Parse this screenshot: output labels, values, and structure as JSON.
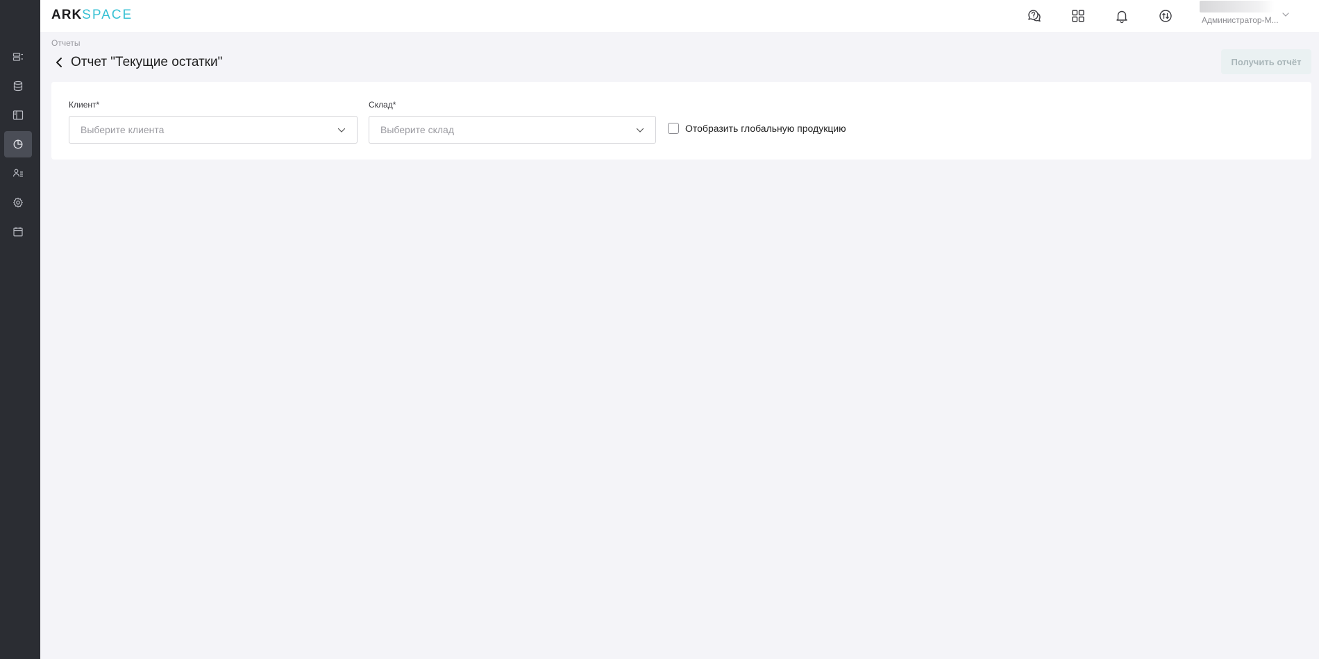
{
  "header": {
    "logo_primary": "ARK",
    "logo_secondary": "SPACE",
    "icons": [
      "support-chat-icon",
      "apps-grid-icon",
      "bell-icon",
      "sync-icon"
    ],
    "user_role": "Администратор-М..."
  },
  "sidebar": {
    "items": [
      {
        "icon": "monitor-list-icon",
        "active": false
      },
      {
        "icon": "database-icon",
        "active": false
      },
      {
        "icon": "layout-panel-icon",
        "active": false
      },
      {
        "icon": "pie-chart-icon",
        "active": true
      },
      {
        "icon": "users-icon",
        "active": false
      },
      {
        "icon": "gear-icon",
        "active": false
      },
      {
        "icon": "calendar-icon",
        "active": false
      }
    ]
  },
  "breadcrumb": "Отчеты",
  "page": {
    "title": "Отчет \"Текущие остатки\"",
    "get_report_label": "Получить отчёт"
  },
  "form": {
    "client_label": "Клиент*",
    "client_placeholder": "Выберите клиента",
    "warehouse_label": "Склад*",
    "warehouse_placeholder": "Выберите склад",
    "global_products_label": "Отобразить глобальную продукцию",
    "global_products_checked": false
  },
  "colors": {
    "sidebar_bg": "#2b2d33",
    "sidebar_active": "#4a4d56",
    "accent": "#38c1d4",
    "page_bg": "#f4f4f8"
  }
}
